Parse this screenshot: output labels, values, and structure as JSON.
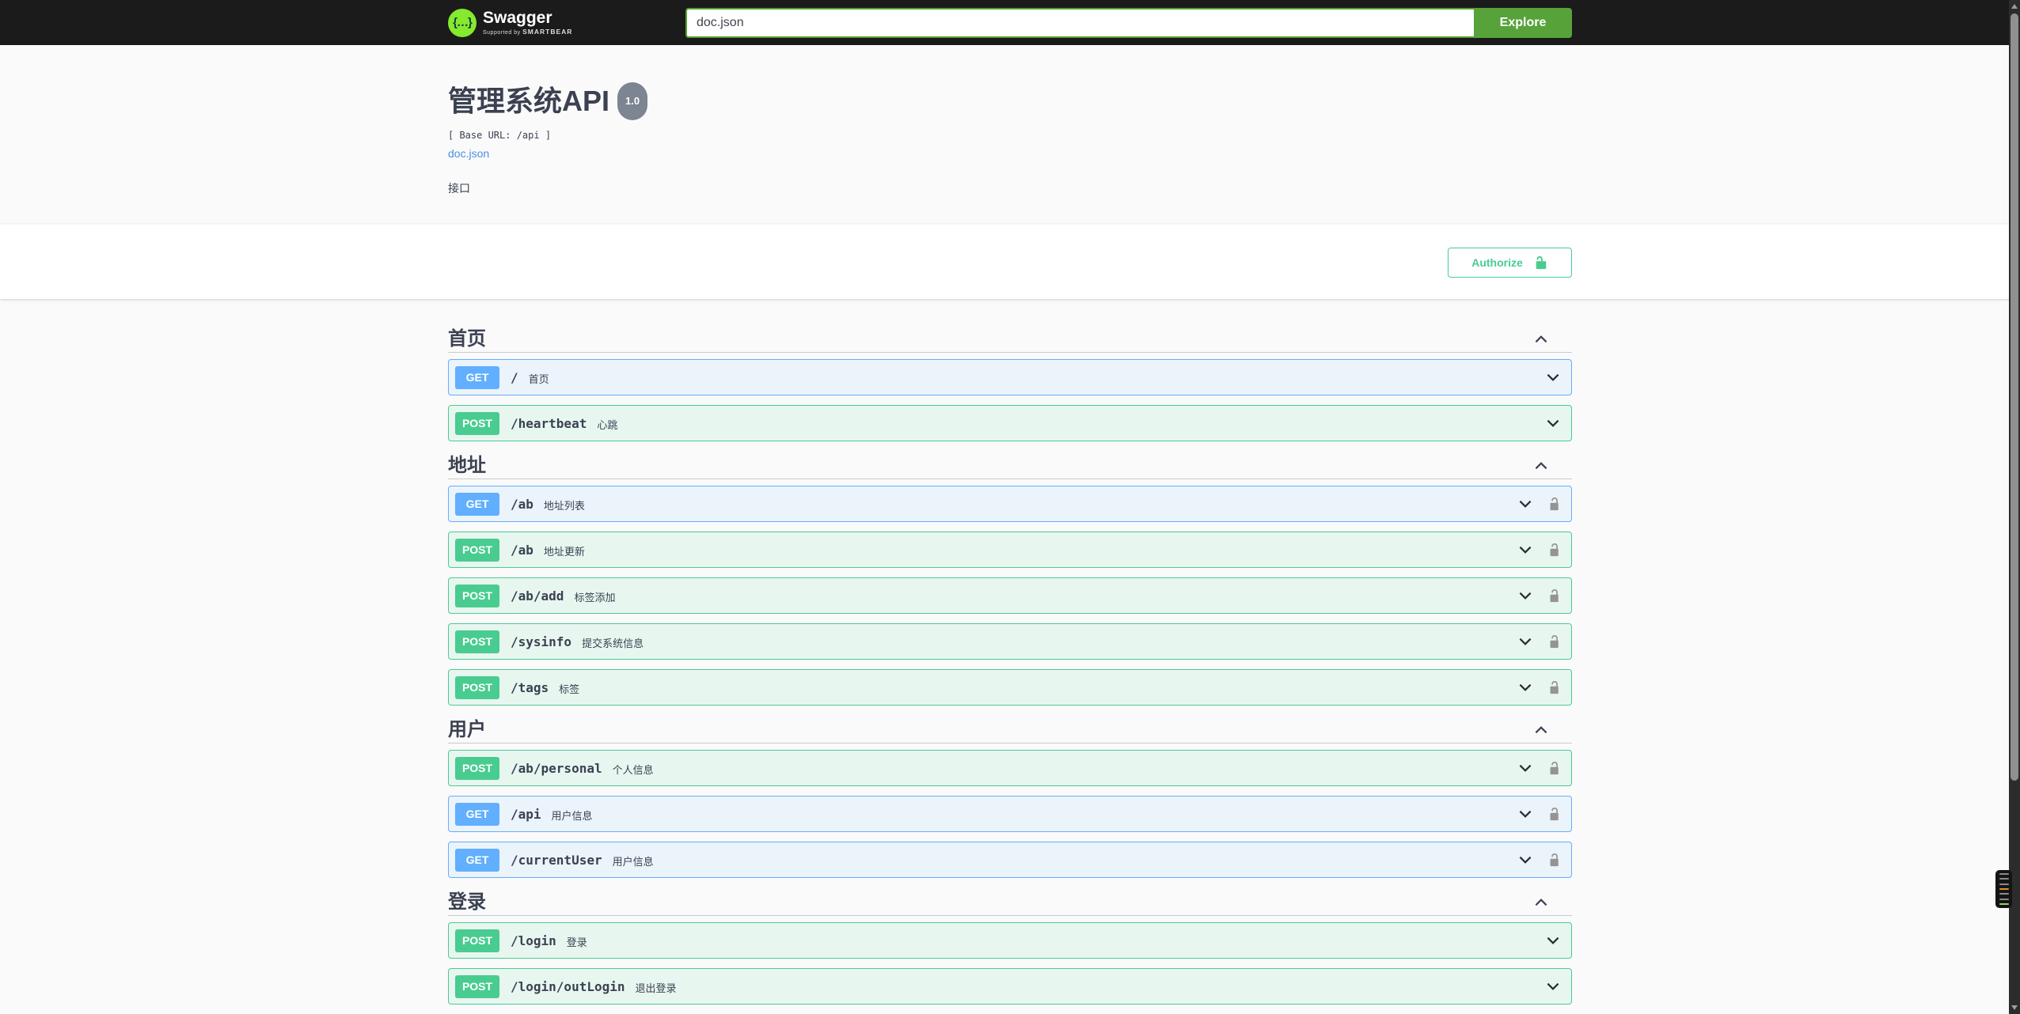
{
  "topbar": {
    "brand": "Swagger",
    "brand_sub_prefix": "Supported by",
    "brand_sub_name": "SMARTBEAR",
    "logo_glyph": "{…}",
    "search_value": "doc.json",
    "explore_label": "Explore"
  },
  "hero": {
    "title": "管理系统API",
    "version_badge": "1.0",
    "base_url": "[ Base URL: /api ]",
    "spec_link": "doc.json",
    "description": "接口"
  },
  "auth": {
    "authorize_label": "Authorize"
  },
  "colors": {
    "topbar_bg": "#1b1b1b",
    "logo_green": "#85ea2d",
    "explore_green": "#57a33a",
    "link_blue": "#4990e2",
    "get_blue": "#61affe",
    "post_green": "#49cc90",
    "authorize_green": "#49cc90",
    "heading_text": "#3b4151",
    "version_badge_bg": "#7d8492"
  },
  "sections": [
    {
      "title": "首页",
      "expanded": true,
      "operations": [
        {
          "method": "GET",
          "path": "/",
          "summary": "首页",
          "locked": false
        },
        {
          "method": "POST",
          "path": "/heartbeat",
          "summary": "心跳",
          "locked": false
        }
      ]
    },
    {
      "title": "地址",
      "expanded": true,
      "operations": [
        {
          "method": "GET",
          "path": "/ab",
          "summary": "地址列表",
          "locked": true
        },
        {
          "method": "POST",
          "path": "/ab",
          "summary": "地址更新",
          "locked": true
        },
        {
          "method": "POST",
          "path": "/ab/add",
          "summary": "标签添加",
          "locked": true
        },
        {
          "method": "POST",
          "path": "/sysinfo",
          "summary": "提交系统信息",
          "locked": true
        },
        {
          "method": "POST",
          "path": "/tags",
          "summary": "标签",
          "locked": true
        }
      ]
    },
    {
      "title": "用户",
      "expanded": true,
      "operations": [
        {
          "method": "POST",
          "path": "/ab/personal",
          "summary": "个人信息",
          "locked": true
        },
        {
          "method": "GET",
          "path": "/api",
          "summary": "用户信息",
          "locked": true
        },
        {
          "method": "GET",
          "path": "/currentUser",
          "summary": "用户信息",
          "locked": true
        }
      ]
    },
    {
      "title": "登录",
      "expanded": true,
      "operations": [
        {
          "method": "POST",
          "path": "/login",
          "summary": "登录",
          "locked": false
        },
        {
          "method": "POST",
          "path": "/login/outLogin",
          "summary": "退出登录",
          "locked": false
        }
      ]
    }
  ]
}
